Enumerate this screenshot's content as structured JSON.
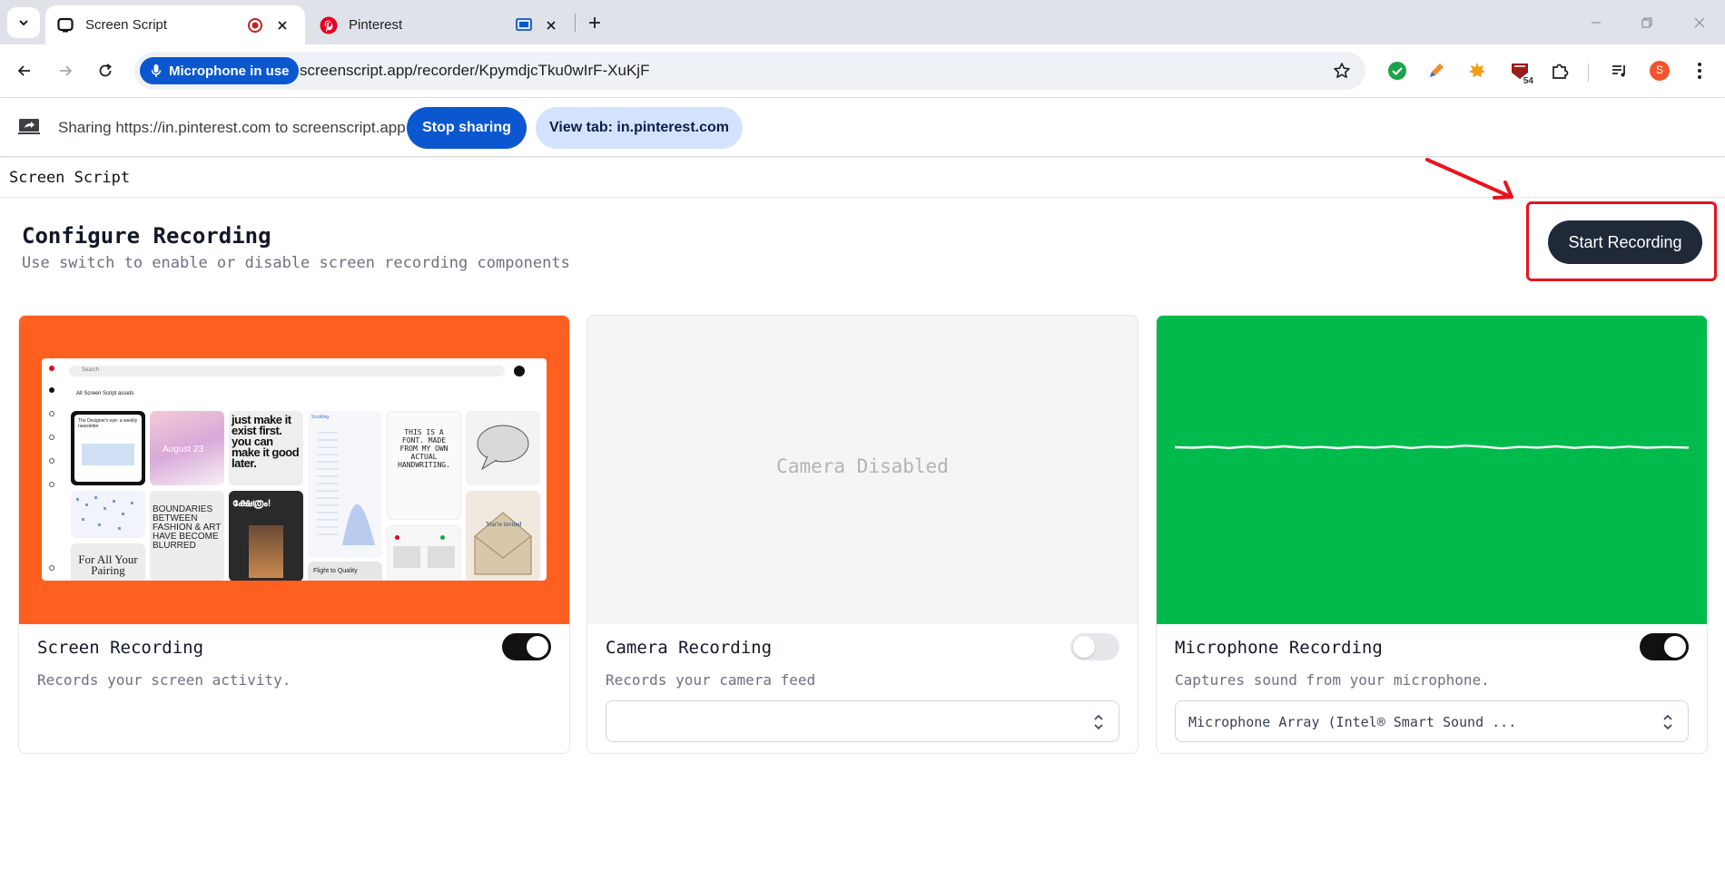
{
  "browser": {
    "tabs": [
      {
        "title": "Screen Script",
        "active": true
      },
      {
        "title": "Pinterest",
        "active": false
      }
    ],
    "mic_chip": "Microphone in use",
    "url": "screenscript.app/recorder/KpymdjcTku0wIrF-XuKjF",
    "extensions": [
      {
        "icon": "check-circle-icon",
        "color": "#1aa34a"
      },
      {
        "icon": "pen-icon",
        "color": "#f28c28"
      },
      {
        "icon": "maple-leaf-icon",
        "color": "#f29d12"
      },
      {
        "icon": "badge-extension-icon",
        "color": "#9a1c1c",
        "badge": "54"
      },
      {
        "icon": "puzzle-icon"
      },
      {
        "icon": "media-queue-icon"
      }
    ],
    "profile_initial": "S",
    "profile_color": "#f2542d"
  },
  "sharebar": {
    "text": "Sharing https://in.pinterest.com to screenscript.app",
    "stop_label": "Stop sharing",
    "view_label": "View tab: in.pinterest.com"
  },
  "app": {
    "name": "Screen Script",
    "title": "Configure Recording",
    "subtitle": "Use switch to enable or disable screen recording components",
    "start_label": "Start Recording",
    "accent_annotation_color": "#e8131c"
  },
  "cards": {
    "screen": {
      "title": "Screen Recording",
      "desc": "Records your screen activity.",
      "enabled": true,
      "bg_color": "#ff5f1f",
      "preview": {
        "search_placeholder": "Search",
        "tabs_text": "All     Screen Script assets",
        "pins": {
          "p1": "The Designer's eye: a weekly newsletter",
          "p2": "August 23",
          "p3": "just make it exist first. you can make it good later.",
          "p4": "Scrolling",
          "p5": "THIS IS A FONT. MADE FROM MY OWN ACTUAL HANDWRITING.",
          "p6": "BOUNDARIES BETWEEN FASHION & ART HAVE BECOME BLURRED",
          "p7": "ക്ഷേത്രം!",
          "p8": "For All Your Pairing",
          "p9": "Flight to Quality",
          "p10": "You're invited"
        }
      }
    },
    "camera": {
      "title": "Camera Recording",
      "desc": "Records your camera feed",
      "enabled": false,
      "placeholder": "Camera Disabled",
      "select_value": ""
    },
    "microphone": {
      "title": "Microphone Recording",
      "desc": "Captures sound from your microphone.",
      "enabled": true,
      "bg_color": "#00bb4c",
      "select_value": "Microphone Array (Intel® Smart Sound ..."
    }
  }
}
